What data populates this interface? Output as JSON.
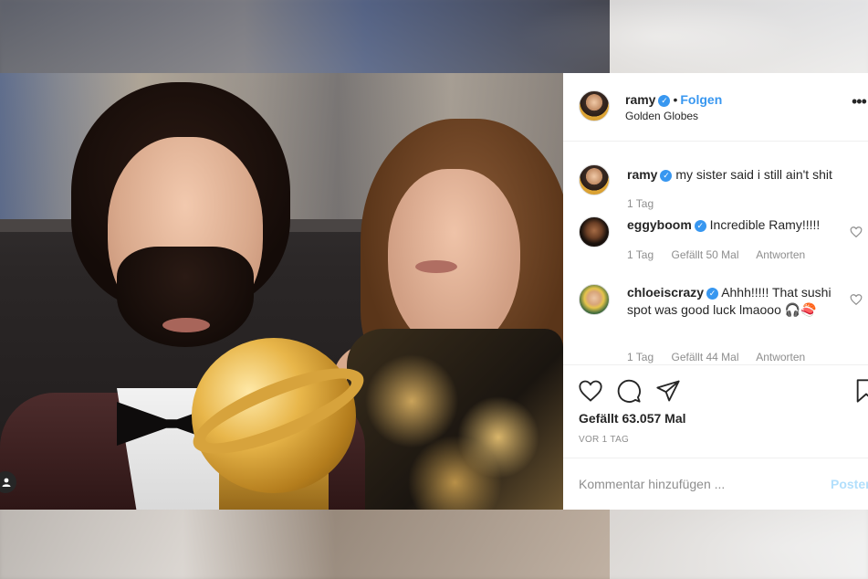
{
  "post": {
    "author": {
      "username": "ramy",
      "verified": true
    },
    "dot_separator": "•",
    "follow_label": "Folgen",
    "location": "Golden Globes",
    "more_icon": "more-horizontal-icon",
    "more_glyph": "•••"
  },
  "comments": [
    {
      "username": "ramy",
      "verified": true,
      "text": "my sister said i still ain't shit",
      "time": "1 Tag",
      "likes": "",
      "reply_label": ""
    },
    {
      "username": "eggyboom",
      "verified": true,
      "text": "Incredible Ramy!!!!!",
      "time": "1 Tag",
      "likes": "Gefällt 50 Mal",
      "reply_label": "Antworten"
    },
    {
      "username": "chloeiscrazy",
      "verified": true,
      "text": "Ahhh!!!!! That sushi spot was good luck lmaooo 🎧🍣",
      "time": "1 Tag",
      "likes": "Gefällt 44 Mal",
      "reply_label": "Antworten"
    }
  ],
  "actions": {
    "like_icon": "heart-icon",
    "comment_icon": "comment-icon",
    "share_icon": "share-icon",
    "save_icon": "bookmark-icon"
  },
  "likes_text": "Gefällt 63.057 Mal",
  "date_text": "VOR 1 TAG",
  "comment_box": {
    "placeholder": "Kommentar hinzufügen ...",
    "post_label": "Posten"
  },
  "colors": {
    "accent": "#3897f0",
    "text": "#262626",
    "muted": "#8e8e8e",
    "post_disabled": "#b2dffc"
  }
}
